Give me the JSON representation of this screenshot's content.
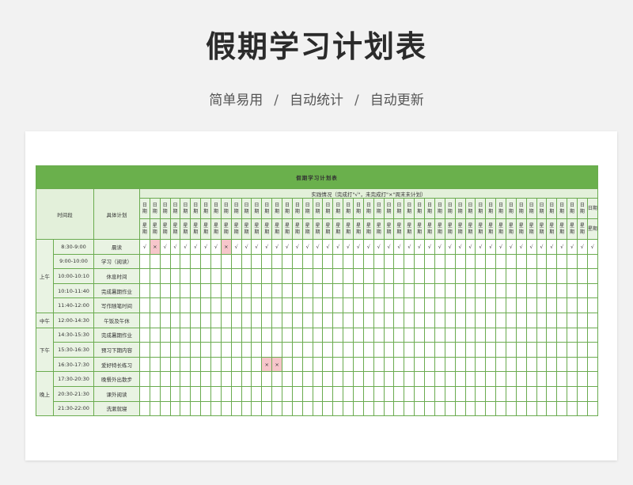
{
  "header": {
    "title": "假期学习计划表",
    "tagline": [
      "简单易用",
      "自动统计",
      "自动更新"
    ],
    "separator": "/"
  },
  "sheet": {
    "title": "假期学习计划表",
    "col_time": "时间段",
    "col_plan": "具体计划",
    "practice_header": "实践情况（完成打\"√\"，未完成打\"×\"周末未计划）",
    "day_count": 45,
    "date_label": "日期",
    "week_label": "星期",
    "colors": {
      "green": "#6ab04c",
      "light": "#e9f3e3",
      "miss": "#f7c6cb"
    },
    "periods": [
      {
        "name": "上午",
        "rows": 5
      },
      {
        "name": "中午",
        "rows": 1
      },
      {
        "name": "下午",
        "rows": 3
      },
      {
        "name": "晚上",
        "rows": 3
      }
    ],
    "rows": [
      {
        "time": "8:30-9:00",
        "plan": "晨读",
        "marks": [
          "√",
          "×",
          "√",
          "√",
          "√",
          "√",
          "√",
          "√",
          "×",
          "√",
          "√",
          "√",
          "√",
          "√",
          "√",
          "√",
          "√",
          "√",
          "√",
          "√",
          "√",
          "√",
          "√",
          "√",
          "√",
          "√",
          "√",
          "√",
          "√",
          "√",
          "√",
          "√",
          "√",
          "√",
          "√",
          "√",
          "√",
          "√",
          "√",
          "√",
          "√",
          "√",
          "√",
          "√",
          "√"
        ]
      },
      {
        "time": "9:00-10:00",
        "plan": "学习（阅读）",
        "marks": []
      },
      {
        "time": "10:00-10:10",
        "plan": "休息时间",
        "marks": []
      },
      {
        "time": "10:10-11:40",
        "plan": "完成暑期作业",
        "marks": []
      },
      {
        "time": "11:40-12:00",
        "plan": "写作随笔时间",
        "marks": []
      },
      {
        "time": "12:00-14:30",
        "plan": "午饭及午休",
        "marks": []
      },
      {
        "time": "14:30-15:30",
        "plan": "完成暑期作业",
        "marks": []
      },
      {
        "time": "15:30-16:30",
        "plan": "预习下期内容",
        "marks": []
      },
      {
        "time": "16:30-17:30",
        "plan": "爱好特长练习",
        "marks": [
          "",
          "",
          "",
          "",
          "",
          "",
          "",
          "",
          "",
          "",
          "",
          "",
          "×",
          "×"
        ]
      },
      {
        "time": "17:30-20:30",
        "plan": "晚餐外出散步",
        "marks": []
      },
      {
        "time": "20:30-21:30",
        "plan": "课外阅读",
        "marks": []
      },
      {
        "time": "21:30-22:00",
        "plan": "洗漱就寝",
        "marks": []
      }
    ]
  }
}
